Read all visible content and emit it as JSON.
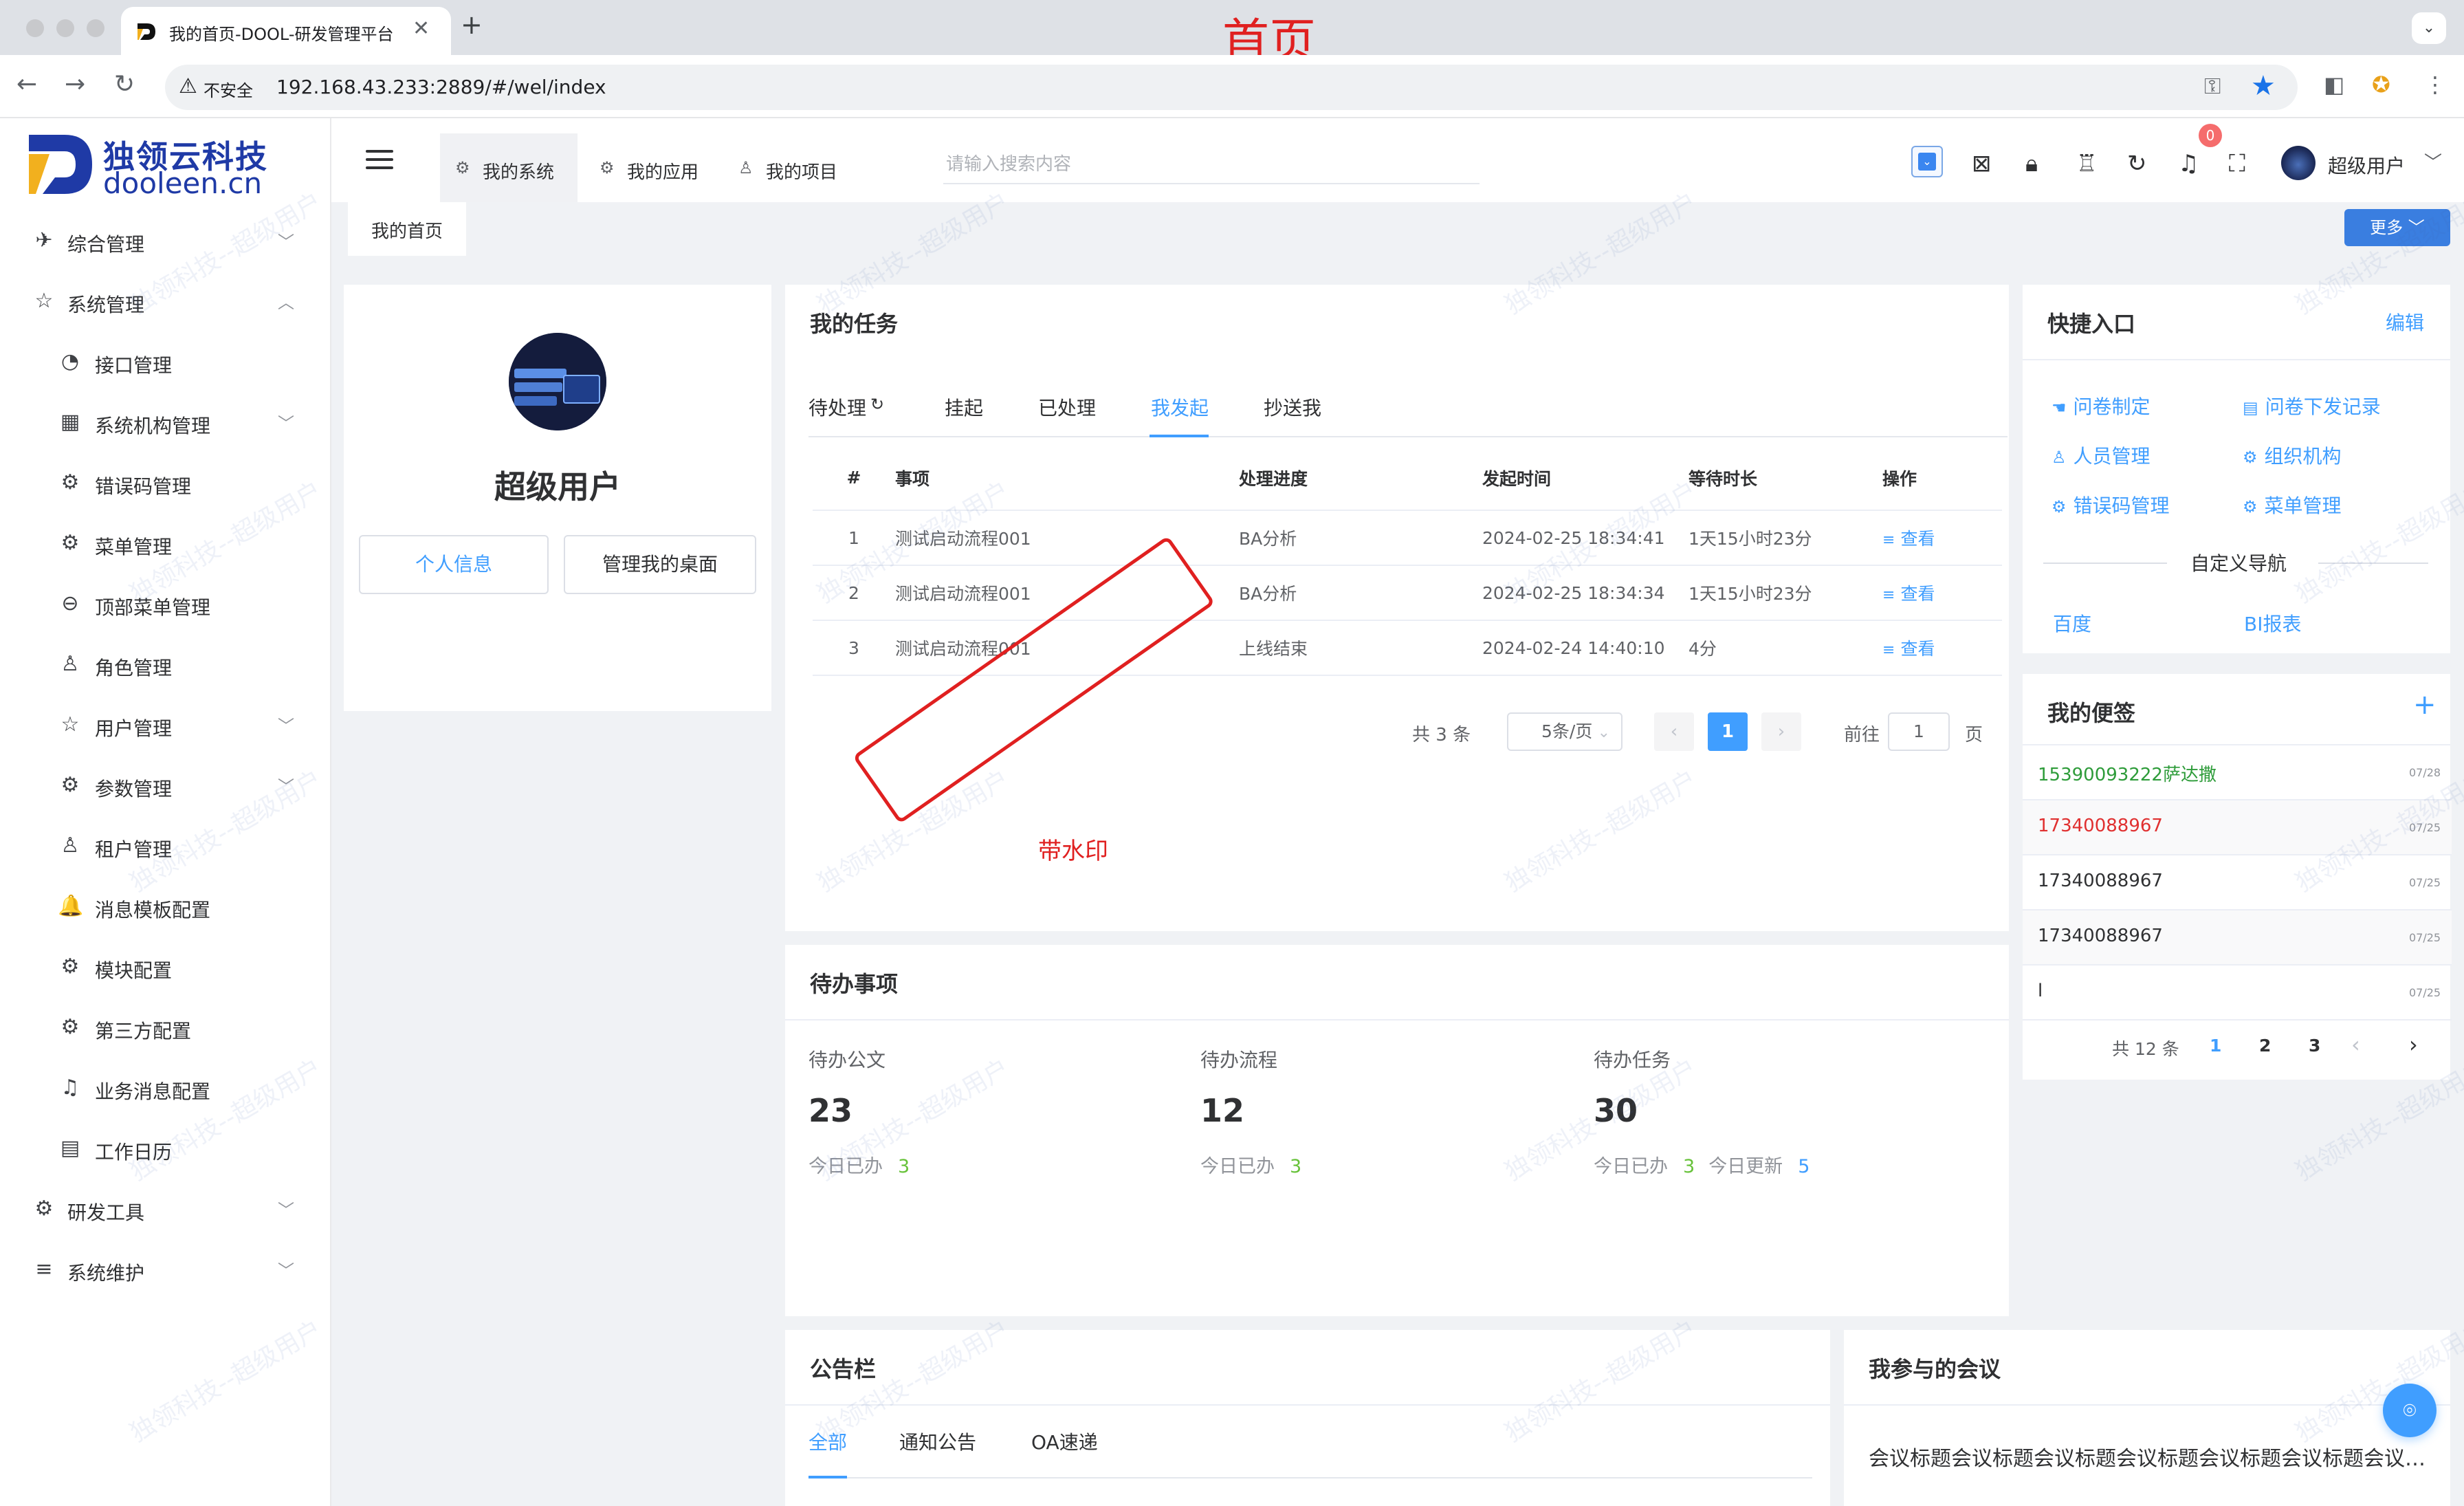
{
  "browser": {
    "tab_title": "我的首页-DOOL-研发管理平台",
    "tab_close": "✕",
    "new_tab": "+",
    "tab_menu": "⌄",
    "insecure_label": "不安全",
    "url": "192.168.43.233:2889/#/wel/index"
  },
  "annotations": {
    "page_title": "首页",
    "watermark_label": "带水印"
  },
  "brand": {
    "name_cn": "独领云科技",
    "name_en": "dooleen.cn",
    "color": "#1f3aa6"
  },
  "sidebar": {
    "items": [
      {
        "label": "综合管理",
        "icon": "paper-plane-icon",
        "glyph": "✈",
        "arrow": "﹀"
      },
      {
        "label": "系统管理",
        "icon": "star-outline-icon",
        "glyph": "☆",
        "arrow": "︿"
      },
      {
        "label": "接口管理",
        "icon": "dashboard-icon",
        "glyph": "◔"
      },
      {
        "label": "系统机构管理",
        "icon": "grid-icon",
        "glyph": "▦",
        "arrow": "﹀"
      },
      {
        "label": "错误码管理",
        "icon": "gear-solid-icon",
        "glyph": "⚙"
      },
      {
        "label": "菜单管理",
        "icon": "gear-outline-icon",
        "glyph": "⚙"
      },
      {
        "label": "顶部菜单管理",
        "icon": "zoom-out-icon",
        "glyph": "⊖"
      },
      {
        "label": "角色管理",
        "icon": "user-icon",
        "glyph": "♙"
      },
      {
        "label": "用户管理",
        "icon": "star-outline-icon",
        "glyph": "☆",
        "arrow": "﹀"
      },
      {
        "label": "参数管理",
        "icon": "gear-outline-icon",
        "glyph": "⚙",
        "arrow": "﹀"
      },
      {
        "label": "租户管理",
        "icon": "user-icon",
        "glyph": "♙"
      },
      {
        "label": "消息模板配置",
        "icon": "bell-solid-icon",
        "glyph": "🔔"
      },
      {
        "label": "模块配置",
        "icon": "gear-outline-icon",
        "glyph": "⚙"
      },
      {
        "label": "第三方配置",
        "icon": "gear-outline-icon",
        "glyph": "⚙"
      },
      {
        "label": "业务消息配置",
        "icon": "bell-outline-icon",
        "glyph": "♫"
      },
      {
        "label": "工作日历",
        "icon": "calendar-icon",
        "glyph": "▤"
      },
      {
        "label": "研发工具",
        "icon": "gear-outline-icon",
        "glyph": "⚙",
        "arrow": "﹀"
      },
      {
        "label": "系统维护",
        "icon": "sliders-icon",
        "glyph": "≡",
        "arrow": "﹀"
      }
    ]
  },
  "topnav": {
    "tabs": [
      {
        "label": "我的系统",
        "icon": "gear-icon",
        "glyph": "⚙"
      },
      {
        "label": "我的应用",
        "icon": "gear-outline-icon",
        "glyph": "⚙"
      },
      {
        "label": "我的项目",
        "icon": "user-icon",
        "glyph": "♙"
      }
    ],
    "search_placeholder": "请输入搜索内容",
    "notification_count": "0",
    "user_name": "超级用户",
    "user_arrow": "﹀"
  },
  "tags": {
    "home": "我的首页",
    "more": "更多 ﹀"
  },
  "profile": {
    "name": "超级用户",
    "info_button": "个人信息",
    "desk_button": "管理我的桌面"
  },
  "tasks": {
    "title": "我的任务",
    "tabs": [
      "待处理",
      "挂起",
      "已处理",
      "我发起",
      "抄送我"
    ],
    "active_tab": "我发起",
    "columns": [
      "#",
      "事项",
      "处理进度",
      "发起时间",
      "等待时长",
      "操作"
    ],
    "rows": [
      {
        "no": "1",
        "item": "测试启动流程001",
        "progress": "BA分析",
        "time": "2024-02-25 18:34:41",
        "wait": "1天15小时23分",
        "action": "查看"
      },
      {
        "no": "2",
        "item": "测试启动流程001",
        "progress": "BA分析",
        "time": "2024-02-25 18:34:34",
        "wait": "1天15小时23分",
        "action": "查看"
      },
      {
        "no": "3",
        "item": "测试启动流程001",
        "progress": "上线结束",
        "time": "2024-02-24 14:40:10",
        "wait": "4分",
        "action": "查看"
      }
    ],
    "pager": {
      "total": "共 3 条",
      "page_size": "5条/页",
      "current": "1",
      "goto_label": "前往",
      "goto_value": "1",
      "page_suffix": "页"
    }
  },
  "pending": {
    "title": "待办事项",
    "stats": [
      {
        "label": "待办公文",
        "value": "23",
        "done_label": "今日已办",
        "done": "3"
      },
      {
        "label": "待办流程",
        "value": "12",
        "done_label": "今日已办",
        "done": "3"
      },
      {
        "label": "待办任务",
        "value": "30",
        "done_label": "今日已办",
        "done": "3",
        "updated_label": "今日更新",
        "updated": "5"
      }
    ]
  },
  "bulletin": {
    "title": "公告栏",
    "tabs": [
      "全部",
      "通知公告",
      "OA速递"
    ]
  },
  "quick": {
    "title": "快捷入口",
    "edit": "编辑",
    "links": [
      {
        "label": "问卷制定",
        "icon": "thumb-icon",
        "glyph": "☚"
      },
      {
        "label": "问卷下发记录",
        "icon": "document-icon",
        "glyph": "▤"
      },
      {
        "label": "人员管理",
        "icon": "user-icon",
        "glyph": "♙"
      },
      {
        "label": "组织机构",
        "icon": "gear-solid-icon",
        "glyph": "⚙"
      },
      {
        "label": "错误码管理",
        "icon": "gear-solid-icon",
        "glyph": "⚙"
      },
      {
        "label": "菜单管理",
        "icon": "gear-outline-icon",
        "glyph": "⚙"
      }
    ],
    "custom_nav_title": "自定义导航",
    "custom_links": [
      "百度",
      "BI报表"
    ]
  },
  "notes": {
    "title": "我的便签",
    "add": "+",
    "items": [
      {
        "text": "15390093222萨达撒",
        "date": "07/28",
        "color": "#2e9c3a"
      },
      {
        "text": "17340088967",
        "date": "07/25",
        "color": "#e03030"
      },
      {
        "text": "17340088967",
        "date": "07/25",
        "color": "#303133"
      },
      {
        "text": "17340088967",
        "date": "07/25",
        "color": "#303133"
      },
      {
        "text": "l",
        "date": "07/25",
        "color": "#303133"
      }
    ],
    "pager": {
      "total": "共 12 条",
      "pages": [
        "1",
        "2",
        "3"
      ],
      "current": "1",
      "prev": "‹",
      "next": "›"
    }
  },
  "meeting": {
    "title": "我参与的会议",
    "first_title": "会议标题会议标题会议标题会议标题会议标题会议标题会议标题会议标题会议标题"
  },
  "watermark_text": "独领科技--超级用户",
  "colors": {
    "accent": "#409eff",
    "success": "#67c23a",
    "danger": "#f56c6c"
  }
}
